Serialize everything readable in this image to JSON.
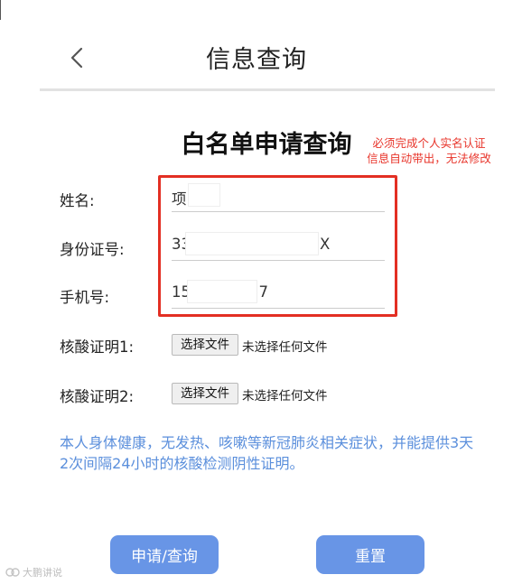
{
  "header": {
    "back_icon": "chevron-left-icon",
    "title": "信息查询"
  },
  "form": {
    "title": "白名单申请查询",
    "annotation_line1": "必须完成个人实名认证",
    "annotation_line2": "信息自动带出，无法修改",
    "highlight_color": "#e32f23",
    "fields": {
      "name": {
        "label": "姓名:",
        "value": "项"
      },
      "id_number": {
        "label": "身份证号:",
        "value_start": "33",
        "value_end": "X"
      },
      "phone": {
        "label": "手机号:",
        "value_start": "15",
        "value_end": "57"
      }
    },
    "files": [
      {
        "label": "核酸证明1:",
        "button": "选择文件",
        "status": "未选择任何文件"
      },
      {
        "label": "核酸证明2:",
        "button": "选择文件",
        "status": "未选择任何文件"
      }
    ],
    "declaration": "本人身体健康，无发热、咳嗽等新冠肺炎相关症状，并能提供3天2次间隔24小时的核酸检测阴性证明。"
  },
  "actions": {
    "submit_label": "申请/查询",
    "reset_label": "重置",
    "button_color": "#6895e6"
  },
  "watermark": {
    "icon": "logo-icon",
    "text": "大鹏讲说"
  }
}
